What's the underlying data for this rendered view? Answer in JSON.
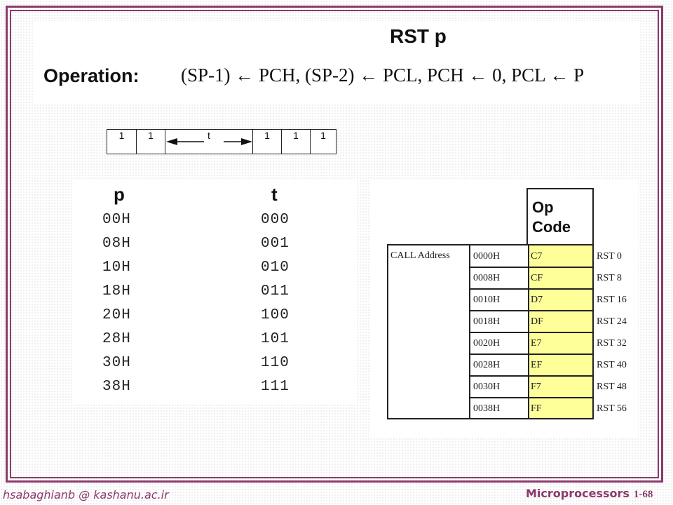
{
  "header": {
    "title": "RST p",
    "operation_label": "Operation:",
    "operation_text": "(SP-1) ← PCH, (SP-2) ← PCL, PCH ← 0, PCL ← P"
  },
  "opcode_strip": {
    "bits": [
      "1",
      "1",
      "t",
      "1",
      "1",
      "1"
    ]
  },
  "pt_table": {
    "headers": [
      "p",
      "t"
    ],
    "rows": [
      [
        "00H",
        "000"
      ],
      [
        "08H",
        "001"
      ],
      [
        "10H",
        "010"
      ],
      [
        "18H",
        "011"
      ],
      [
        "20H",
        "100"
      ],
      [
        "28H",
        "101"
      ],
      [
        "30H",
        "110"
      ],
      [
        "38H",
        "111"
      ]
    ]
  },
  "call_table": {
    "opcode_header": "Op\nCode",
    "opcode_header_line1": "Op",
    "opcode_header_line2": "Code",
    "row_label": "CALL Address",
    "rows": [
      {
        "addr": "0000H",
        "code": "C7",
        "rst": "RST 0"
      },
      {
        "addr": "0008H",
        "code": "CF",
        "rst": "RST 8"
      },
      {
        "addr": "0010H",
        "code": "D7",
        "rst": "RST 16"
      },
      {
        "addr": "0018H",
        "code": "DF",
        "rst": "RST 24"
      },
      {
        "addr": "0020H",
        "code": "E7",
        "rst": "RST 32"
      },
      {
        "addr": "0028H",
        "code": "EF",
        "rst": "RST 40"
      },
      {
        "addr": "0030H",
        "code": "F7",
        "rst": "RST 48"
      },
      {
        "addr": "0038H",
        "code": "FF",
        "rst": "RST 56"
      }
    ],
    "highlight_color": "#ffff99"
  },
  "footer": {
    "email": "hsabaghianb @ kashanu.ac.ir",
    "course": "Microprocessors",
    "page": "1-68"
  },
  "colors": {
    "frame": "#8b3a6b"
  }
}
